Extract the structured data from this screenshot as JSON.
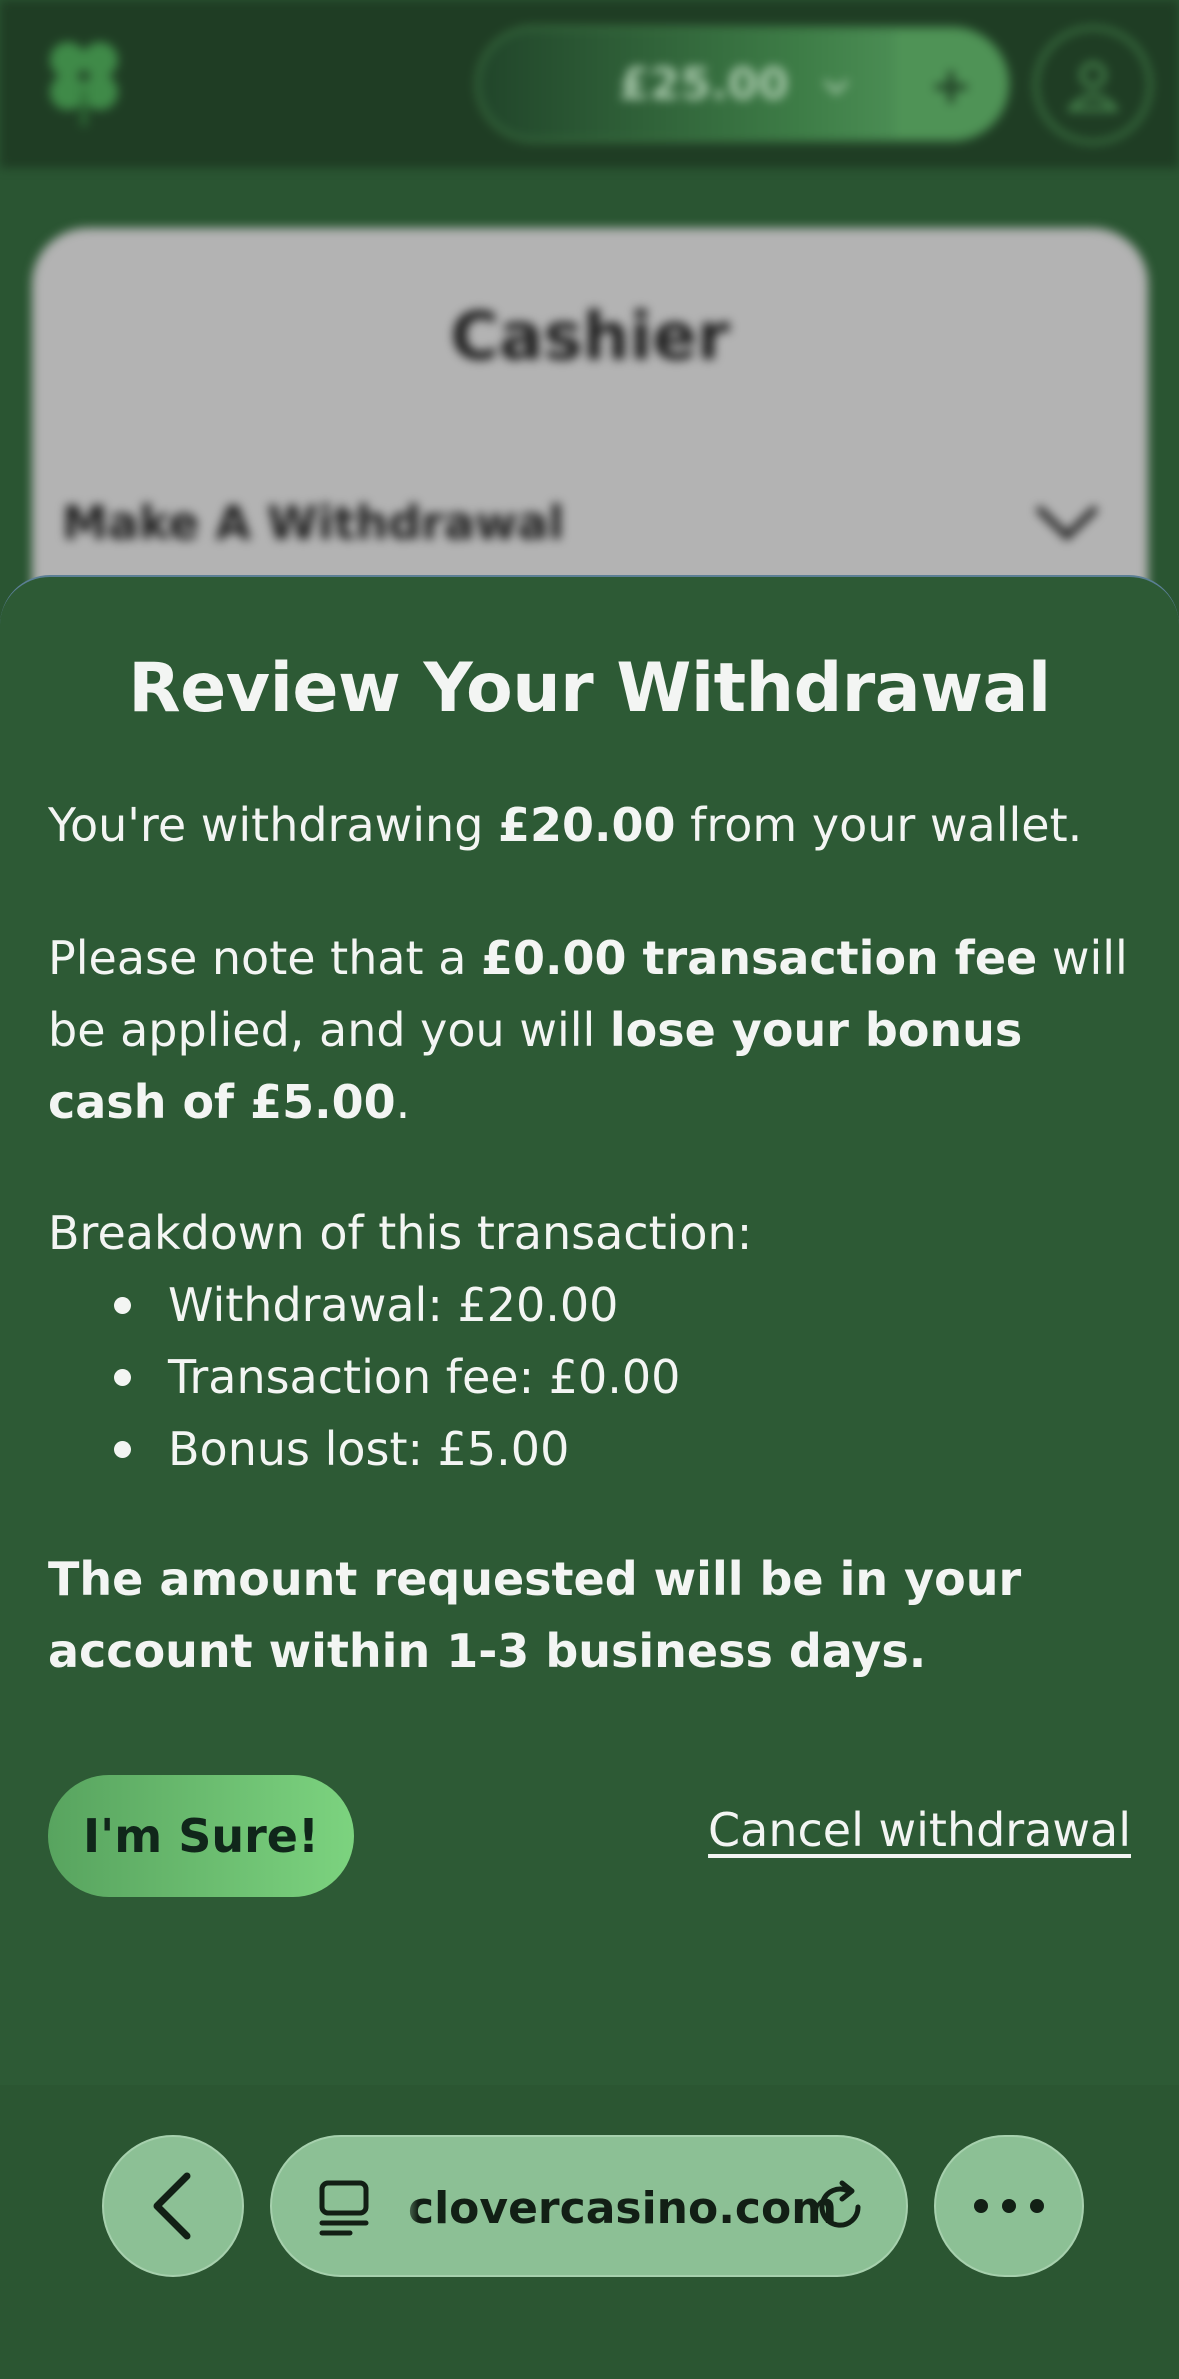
{
  "background_page": {
    "balance": "£25.00",
    "cashier_title": "Cashier",
    "section_label": "Make A Withdrawal"
  },
  "modal": {
    "title": "Review Your Withdrawal",
    "line1_prefix": "You're withdrawing ",
    "line1_amount": "£20.00",
    "line1_suffix": " from your wallet.",
    "line2_a": "Please note that a ",
    "line2_fee": "£0.00 transaction fee",
    "line2_b": " will be applied, and you will ",
    "line2_bonus": "lose your bonus cash of £5.00",
    "line2_end": ".",
    "breakdown_heading": "Breakdown of this transaction:",
    "breakdown": [
      "Withdrawal: £20.00",
      "Transaction fee: £0.00",
      "Bonus lost: £5.00"
    ],
    "notice": "The amount requested will be in your account within 1-3 business days.",
    "confirm_label": "I'm Sure!",
    "cancel_label": "Cancel withdrawal"
  },
  "browser": {
    "url": "clovercasino.com"
  },
  "colors": {
    "sheet_bg": "#2d5a35",
    "accent_green": "#7cd37f",
    "browser_pill": "#8cc095"
  },
  "icons": [
    "clover-logo-icon",
    "chevron-down-icon",
    "plus-icon",
    "user-icon",
    "back-chevron-icon",
    "tabs-icon",
    "reload-icon",
    "more-icon"
  ]
}
